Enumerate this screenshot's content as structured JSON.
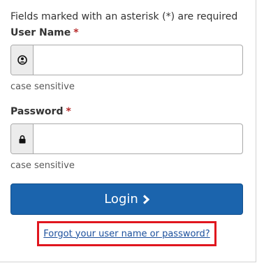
{
  "form": {
    "required_note": "Fields marked with an asterisk (*) are required",
    "asterisk": "*",
    "username": {
      "label": "User Name",
      "icon": "user-icon",
      "value": "",
      "hint": "case sensitive"
    },
    "password": {
      "label": "Password",
      "icon": "lock-icon",
      "value": "",
      "hint": "case sensitive"
    },
    "login_label": "Login",
    "forgot_link": "Forgot your user name or password?"
  },
  "colors": {
    "button_bg": "#1b64ad",
    "required_asterisk": "#b72b2b",
    "link": "#1b4f9c",
    "highlight_border": "#e0161e"
  }
}
